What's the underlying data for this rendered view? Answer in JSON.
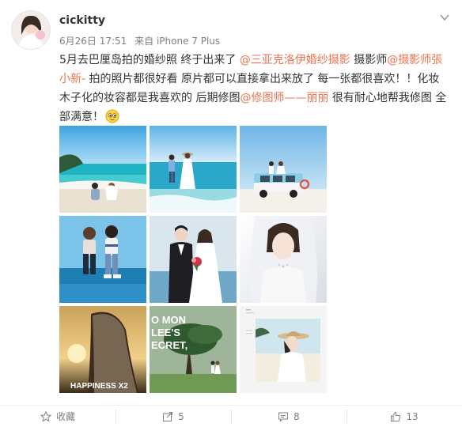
{
  "user": {
    "name": "cickitty",
    "date": "6月26日 17:51",
    "source": "来自 iPhone 7 Plus"
  },
  "post": {
    "line_1": "5月去巴厘岛拍的婚纱照 终于出来了 ",
    "mention_1": "@三亚克洛伊婚纱摄影",
    "line_2": " 摄影师",
    "mention_2": "@摄影师張小新-",
    "line_3": " 拍的照片都很好看 原片都可以直接拿出来放了 每一张都很喜欢！！化妆木子化的妆容都是我喜欢的  后期修图",
    "mention_3": "@修图师——丽丽",
    "line_4": " 很有耐心地帮我修图 全部满意！",
    "emoji": "smile-emoji"
  },
  "photos": {
    "p1_caption": "",
    "p7_text": "HAPPINESS X2",
    "p8_text_1": "O MON",
    "p8_text_2": "LEE'S",
    "p8_text_3": "ECRET,"
  },
  "actions": {
    "favorite_label": "收藏",
    "repost_count": "5",
    "comment_count": "8",
    "like_count": "13"
  },
  "colors": {
    "link": "#eb7350",
    "muted": "#808080",
    "text": "#333333"
  }
}
